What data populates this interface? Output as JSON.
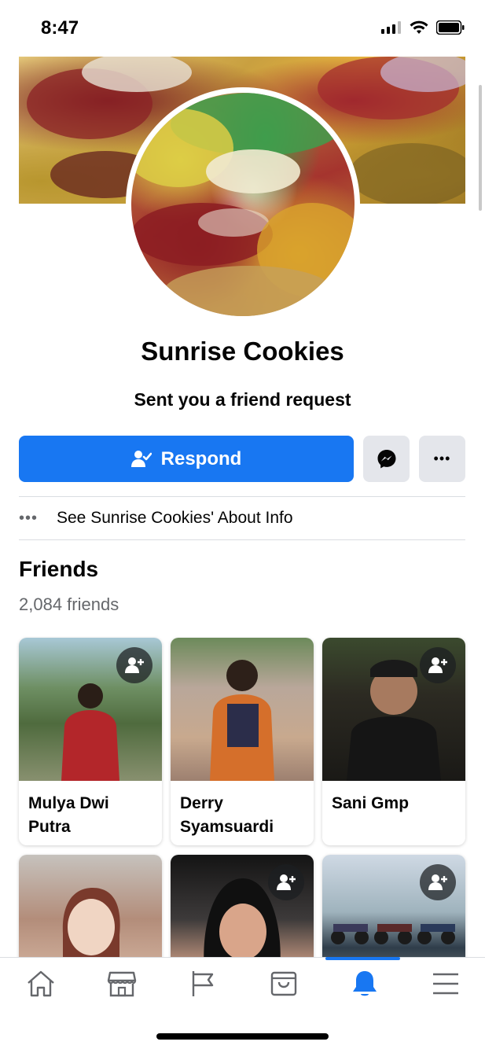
{
  "status_bar": {
    "time": "8:47"
  },
  "profile": {
    "name": "Sunrise Cookies",
    "subtitle": "Sent you a friend request"
  },
  "actions": {
    "respond_label": "Respond",
    "more_label": "•••"
  },
  "about": {
    "dots": "•••",
    "text": "See Sunrise Cookies' About Info"
  },
  "friends": {
    "title": "Friends",
    "count": "2,084 friends",
    "items": [
      {
        "name": "Mulya Dwi Putra"
      },
      {
        "name": "Derry Syamsuardi"
      },
      {
        "name": "Sani Gmp"
      },
      {
        "name": ""
      },
      {
        "name": ""
      },
      {
        "name": ""
      }
    ]
  },
  "tabs": [
    {
      "icon": "home-icon"
    },
    {
      "icon": "marketplace-icon"
    },
    {
      "icon": "pages-flag-icon"
    },
    {
      "icon": "shop-bag-icon"
    },
    {
      "icon": "notifications-bell-icon",
      "active": true
    },
    {
      "icon": "menu-icon"
    }
  ],
  "colors": {
    "accent": "#1877f2",
    "secondary_button": "#e4e6eb",
    "muted_text": "#65676b"
  }
}
